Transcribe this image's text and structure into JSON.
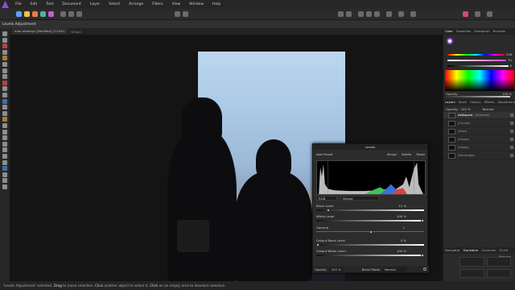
{
  "menubar": {
    "items": [
      "File",
      "Edit",
      "Text",
      "Document",
      "Layer",
      "Select",
      "Arrange",
      "Filters",
      "View",
      "Window",
      "Help"
    ]
  },
  "context": {
    "tool_name": "Levels Adjustment"
  },
  "document_tabs": [
    {
      "label": "man.afdesign [Modified] (23.8%)"
    }
  ],
  "canvas_hint": "300dpi",
  "right_panel": {
    "top_tabs": [
      "Color",
      "Swatches",
      "Histogram",
      "Brushes"
    ],
    "color_values": {
      "h": "238",
      "s": "34",
      "l": "0"
    },
    "opacity_label": "Opacity",
    "opacity_value": "100 %",
    "layers_tabs": [
      "Layers",
      "Stock",
      "History",
      "Effects",
      "Adjustment"
    ],
    "layers_opacity_label": "Opacity:",
    "layers_opacity_value": "100 %",
    "blend_mode": "Normal",
    "layers": [
      {
        "name": "Artboard",
        "sub": "(Artboard)"
      },
      {
        "name": "",
        "sub": "(Curves)"
      },
      {
        "name": "",
        "sub": "(Pixel)"
      },
      {
        "name": "",
        "sub": "(Image)"
      },
      {
        "name": "",
        "sub": "(Image)"
      },
      {
        "name": "",
        "sub": "(Rectangle)"
      }
    ],
    "nav_tabs": [
      "Navigator",
      "Transform",
      "Channels",
      "32-bit Preview"
    ]
  },
  "levels_dialog": {
    "title": "Levels",
    "add_preset": "Add Preset",
    "merge": "Merge",
    "delete": "Delete",
    "reset": "Reset",
    "channel_select": "RGB",
    "mode_select": "Master",
    "rows": [
      {
        "label": "Black Level",
        "value": "11 %"
      },
      {
        "label": "White Level",
        "value": "100 %"
      },
      {
        "label": "Gamma",
        "value": "1"
      },
      {
        "label": "Output Black Level",
        "value": "0 %"
      },
      {
        "label": "Output White Level",
        "value": "100 %"
      }
    ],
    "footer_opacity_label": "Opacity",
    "footer_opacity_value": "100 %",
    "footer_blend_label": "Blend Mode",
    "footer_blend_value": "Normal"
  },
  "status": {
    "part1": "'Levels Adjustment' selected.",
    "drag": "Drag",
    "part2": "to move selection.",
    "click1": "Click",
    "part3": "another object to select it.",
    "click2": "Click",
    "part4": "on an empty area to deselect selection."
  },
  "colors": {
    "accent_purple": "#8a4dd6",
    "hist_blue": "#3a6fd8",
    "hist_green": "#3ec25a",
    "hist_red": "#d84343"
  }
}
